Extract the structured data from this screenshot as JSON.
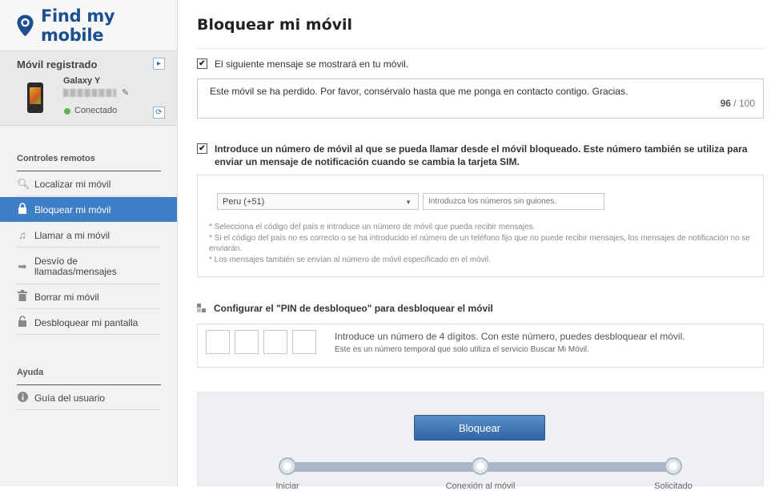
{
  "app": {
    "title": "Find my mobile"
  },
  "device_panel": {
    "title": "Móvil registrado",
    "model": "Galaxy Y",
    "status": "Conectado"
  },
  "sidebar": {
    "remote_title": "Controles remotos",
    "items": [
      {
        "label": "Localizar mi móvil",
        "icon": "search-icon"
      },
      {
        "label": "Bloquear mi móvil",
        "icon": "lock-icon",
        "active": true
      },
      {
        "label": "Llamar a mi móvil",
        "icon": "music-note-icon"
      },
      {
        "label": "Desvío de llamadas/mensajes",
        "icon": "arrow-right-icon"
      },
      {
        "label": "Borrar mi móvil",
        "icon": "trash-icon"
      },
      {
        "label": "Desbloquear mi pantalla",
        "icon": "unlock-icon"
      }
    ],
    "help_title": "Ayuda",
    "help_items": [
      {
        "label": "Guía del usuario",
        "icon": "info-icon"
      }
    ]
  },
  "main": {
    "title": "Bloquear mi móvil",
    "message_option": {
      "checked": true,
      "label": "El siguiente mensaje se mostrará en tu móvil.",
      "text": "Este móvil se ha perdido. Por favor, consérvalo hasta que me ponga en contacto contigo. Gracias.",
      "count": "96",
      "count_sep": " / ",
      "max": "100"
    },
    "number_option": {
      "checked": true,
      "label": "Introduce un número de móvil al que se pueda llamar desde el móvil bloqueado. Este número también se utiliza para enviar un mensaje de notificación cuando se cambia la tarjeta SIM.",
      "country_selected": "Peru (+51)",
      "number_placeholder": "Introduzca los números sin guiones.",
      "notes": [
        "* Selecciona el código del país e introduce un número de móvil que pueda recibir mensajes.",
        "* Si el código del país no es correcto o se ha introducido el número de un teléfono fijo que no puede recibir mensajes, los mensajes de notificación no se enviarán.",
        "* Los mensajes también se envían al número de móvil especificado en el móvil."
      ]
    },
    "pin_section": {
      "title": "Configurar el \"PIN de desbloqueo\" para desbloquear el móvil",
      "instruction": "Introduce un número de 4 dígitos. Con este número, puedes desbloquear el móvil.",
      "subtext": "Este es un número temporal que solo utiliza el servicio Buscar Mi Móvil."
    },
    "lock_button": "Bloquear",
    "steps": [
      "Iniciar",
      "Conexión al móvil",
      "Solicitado"
    ]
  },
  "colors": {
    "brand": "#1c4f8e",
    "active_nav": "#3d7ec6",
    "button": "#2f66a6"
  }
}
